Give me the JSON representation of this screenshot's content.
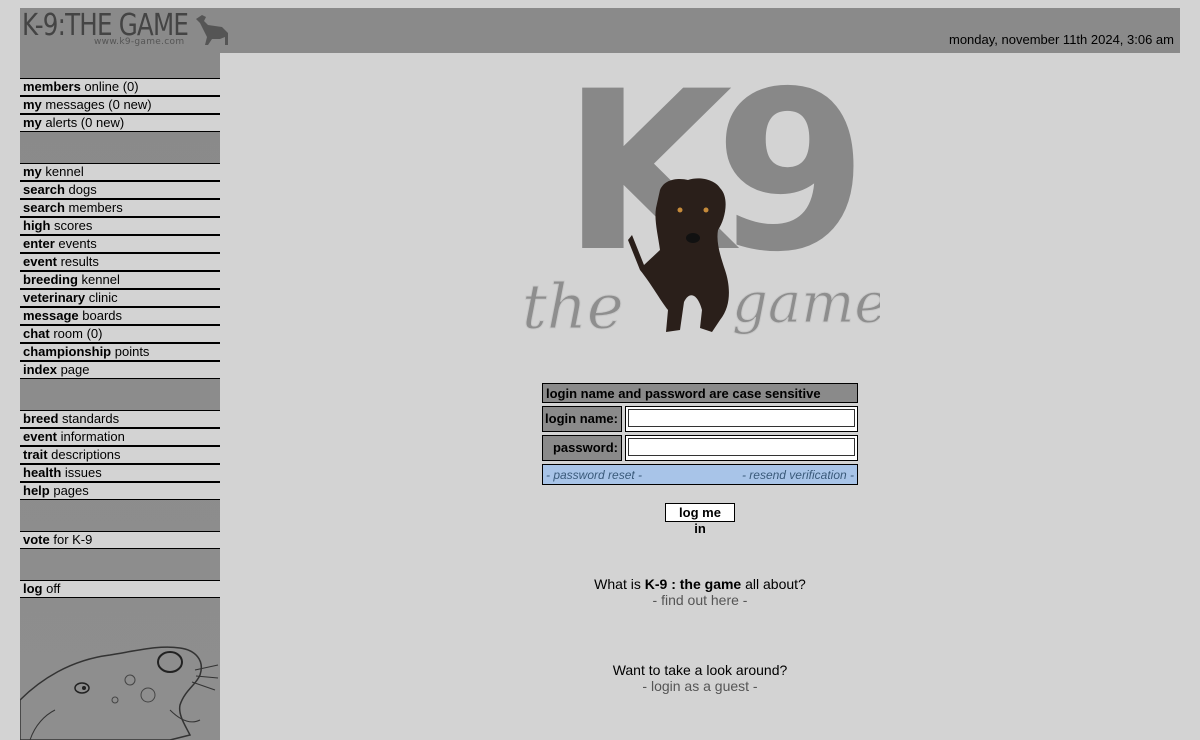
{
  "header": {
    "logo_text": "K-9:THE GAME",
    "logo_url": "www.k9-game.com",
    "datetime": "monday, november 11th 2024, 3:06 am"
  },
  "sidebar": {
    "group1": [
      {
        "bold": "members",
        "rest": " online (0)"
      },
      {
        "bold": "my",
        "rest": " messages (0 new)"
      },
      {
        "bold": "my",
        "rest": " alerts (0 new)"
      }
    ],
    "group2": [
      {
        "bold": "my",
        "rest": " kennel"
      },
      {
        "bold": "search",
        "rest": " dogs"
      },
      {
        "bold": "search",
        "rest": " members"
      },
      {
        "bold": "high",
        "rest": " scores"
      },
      {
        "bold": "enter",
        "rest": " events"
      },
      {
        "bold": "event",
        "rest": " results"
      },
      {
        "bold": "breeding",
        "rest": " kennel"
      },
      {
        "bold": "veterinary",
        "rest": " clinic"
      },
      {
        "bold": "message",
        "rest": " boards"
      },
      {
        "bold": "chat",
        "rest": " room (0)"
      },
      {
        "bold": "championship",
        "rest": " points"
      },
      {
        "bold": "index",
        "rest": " page"
      }
    ],
    "group3": [
      {
        "bold": "breed",
        "rest": " standards"
      },
      {
        "bold": "event",
        "rest": " information"
      },
      {
        "bold": "trait",
        "rest": " descriptions"
      },
      {
        "bold": "health",
        "rest": " issues"
      },
      {
        "bold": "help",
        "rest": " pages"
      }
    ],
    "group4": [
      {
        "bold": "vote",
        "rest": " for K-9"
      }
    ],
    "group5": [
      {
        "bold": "log",
        "rest": " off"
      }
    ]
  },
  "main_logo": {
    "big": "K9",
    "left": "the",
    "right": "game"
  },
  "login": {
    "notice": "login name and password are case sensitive",
    "login_label": "login name:",
    "password_label": "password:",
    "login_value": "",
    "password_value": "",
    "password_reset": "- password reset -",
    "resend_verification": "- resend verification -",
    "button": "log me in"
  },
  "info": {
    "about_prefix": "What is ",
    "about_bold": "K-9 : the game",
    "about_suffix": " all about?",
    "about_link": "- find out here -",
    "guest_text": "Want to take a look around?",
    "guest_link": "- login as a guest -"
  },
  "colors": {
    "background": "#d3d3d3",
    "panel": "#8a8a8a",
    "link_bar": "#a8c4e8"
  }
}
